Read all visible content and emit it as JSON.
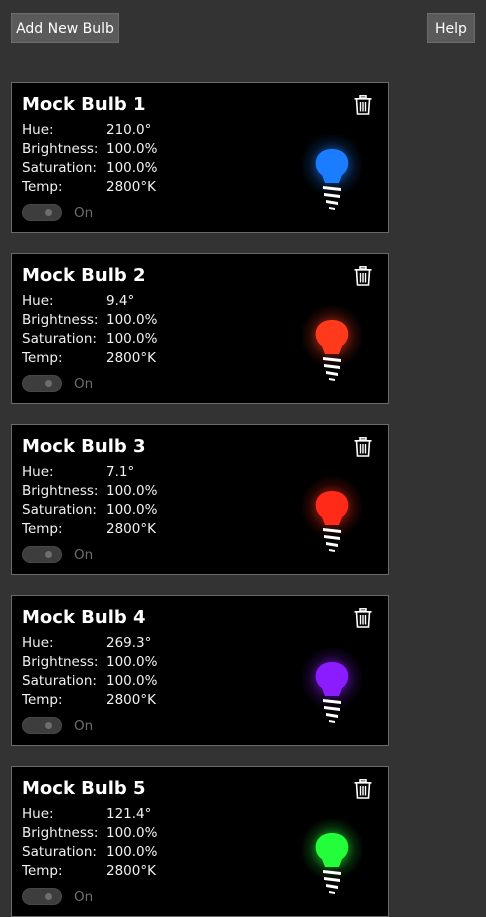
{
  "toolbar": {
    "add_label": "Add New Bulb",
    "help_label": "Help"
  },
  "labels": {
    "hue": "Hue:",
    "brightness": "Brightness:",
    "saturation": "Saturation:",
    "temp": "Temp:",
    "on": "On"
  },
  "bulbs": [
    {
      "name": "Mock Bulb 1",
      "hue": "210.0°",
      "brightness": "100.0%",
      "saturation": "100.0%",
      "temp": "2800°K",
      "color": "#1a7cff",
      "on": false
    },
    {
      "name": "Mock Bulb 2",
      "hue": "9.4°",
      "brightness": "100.0%",
      "saturation": "100.0%",
      "temp": "2800°K",
      "color": "#ff3a1c",
      "on": false
    },
    {
      "name": "Mock Bulb 3",
      "hue": "7.1°",
      "brightness": "100.0%",
      "saturation": "100.0%",
      "temp": "2800°K",
      "color": "#ff2a18",
      "on": false
    },
    {
      "name": "Mock Bulb 4",
      "hue": "269.3°",
      "brightness": "100.0%",
      "saturation": "100.0%",
      "temp": "2800°K",
      "color": "#8a1cff",
      "on": false
    },
    {
      "name": "Mock Bulb 5",
      "hue": "121.4°",
      "brightness": "100.0%",
      "saturation": "100.0%",
      "temp": "2800°K",
      "color": "#22ff3a",
      "on": false
    }
  ]
}
